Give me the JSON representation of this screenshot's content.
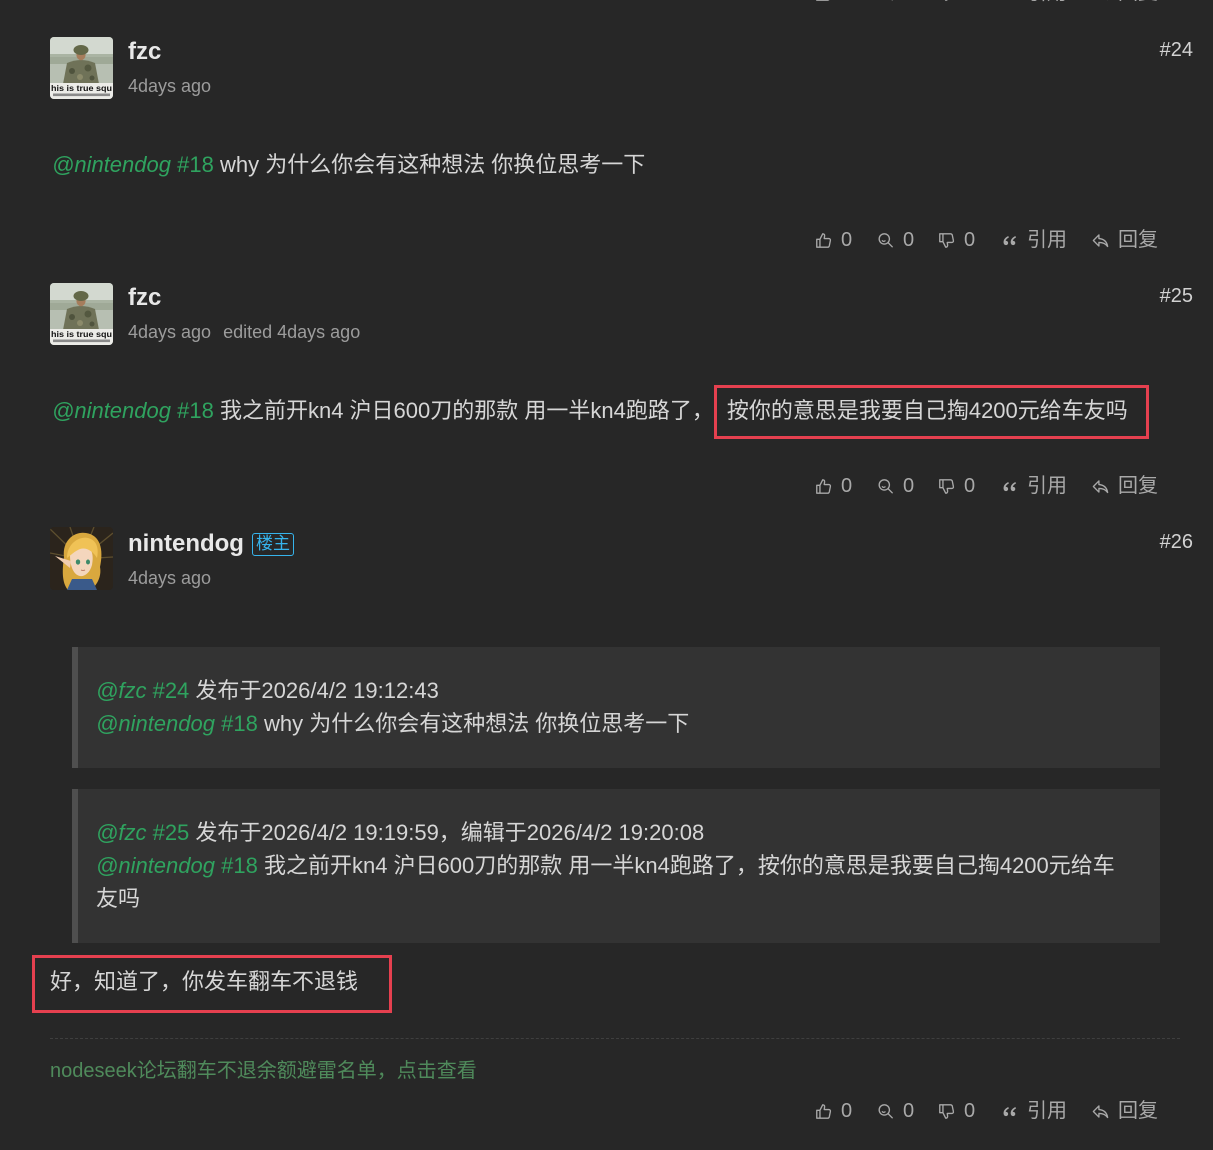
{
  "colors": {
    "page_background": "#272727",
    "quote_background": "#333333",
    "quote_bar": "#4f4f4f",
    "text": "#d6d6d6",
    "mention": "#2fa35f",
    "signature": "#4f8a5b",
    "owner_badge": "#36b4ec",
    "highlight_box": "#e5404f"
  },
  "icons": {
    "like": "thumbs-up-icon",
    "drumstick": "drumstick-icon",
    "dislike": "thumbs-down-icon",
    "quote": "quote-icon",
    "reply": "reply-icon"
  },
  "previous_post_actions": {
    "quote_label": "引用",
    "reply_label": "回复"
  },
  "posts": [
    {
      "username": "fzc",
      "avatar_caption": "his is true squ",
      "time": "4days ago",
      "floor": "#24",
      "body": {
        "mention": "@nintendog",
        "ref": "#18",
        "text": "why 为什么你会有这种想法 你换位思考一下"
      },
      "actions": {
        "like_count": "0",
        "drumstick_count": "0",
        "dislike_count": "0",
        "quote_label": "引用",
        "reply_label": "回复"
      }
    },
    {
      "username": "fzc",
      "avatar_caption": "his is true squ",
      "time": "4days ago",
      "edited": "edited 4days ago",
      "floor": "#25",
      "body": {
        "mention": "@nintendog",
        "ref": "#18",
        "text": "我之前开kn4 沪日600刀的那款 用一半kn4跑路了，",
        "highlighted_text": "按你的意思是我要自己掏4200元给车友吗"
      },
      "actions": {
        "like_count": "0",
        "drumstick_count": "0",
        "dislike_count": "0",
        "quote_label": "引用",
        "reply_label": "回复"
      }
    },
    {
      "username": "nintendog",
      "badge": "楼主",
      "time": "4days ago",
      "floor": "#26",
      "quotes": [
        {
          "mention": "@fzc",
          "ref": "#24",
          "meta": "发布于2026/4/2 19:12:43",
          "body_mention": "@nintendog",
          "body_ref": "#18",
          "body_text": "why 为什么你会有这种想法 你换位思考一下"
        },
        {
          "mention": "@fzc",
          "ref": "#25",
          "meta": "发布于2026/4/2 19:19:59，编辑于2026/4/2 19:20:08",
          "body_mention": "@nintendog",
          "body_ref": "#18",
          "body_text": "我之前开kn4 沪日600刀的那款 用一半kn4跑路了，按你的意思是我要自己掏4200元给车友吗"
        }
      ],
      "body": {
        "highlighted_text": "好，知道了，你发车翻车不退钱"
      },
      "signature": "nodeseek论坛翻车不退余额避雷名单，点击查看",
      "actions": {
        "like_count": "0",
        "drumstick_count": "0",
        "dislike_count": "0",
        "quote_label": "引用",
        "reply_label": "回复"
      }
    }
  ]
}
